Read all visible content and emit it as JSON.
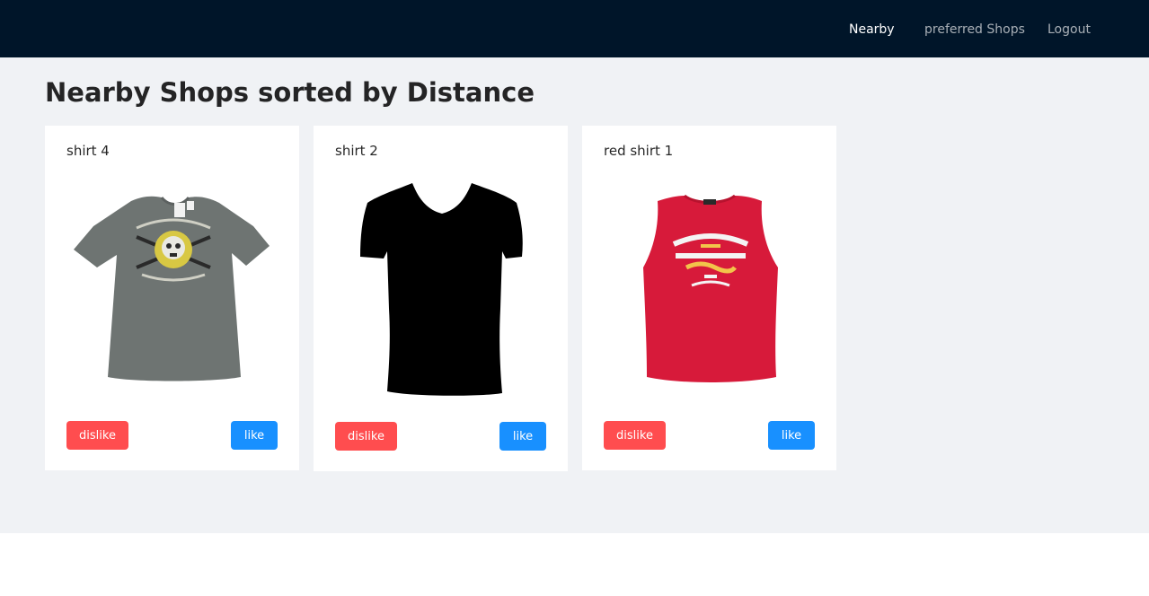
{
  "nav": {
    "items": [
      {
        "label": "Nearby",
        "active": true
      },
      {
        "label": "preferred Shops",
        "active": false
      },
      {
        "label": "Logout",
        "active": false
      }
    ]
  },
  "page": {
    "title": "Nearby Shops sorted by Distance"
  },
  "shops": [
    {
      "name": "shirt 4",
      "image": "grey-skull-tshirt",
      "dislike_label": "dislike",
      "like_label": "like"
    },
    {
      "name": "shirt 2",
      "image": "black-vneck-silhouette",
      "dislike_label": "dislike",
      "like_label": "like"
    },
    {
      "name": "red shirt 1",
      "image": "red-dsquared-tanktop",
      "dislike_label": "dislike",
      "like_label": "like"
    }
  ],
  "colors": {
    "navbar": "#001529",
    "background": "#f0f2f5",
    "dislike": "#ff4d4f",
    "like": "#1890ff"
  }
}
